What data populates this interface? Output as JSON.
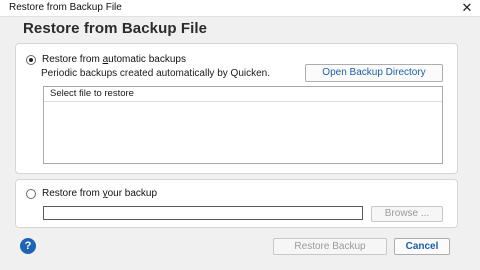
{
  "window": {
    "title": "Restore from Backup File",
    "close_glyph": "✕"
  },
  "heading": "Restore from Backup File",
  "auto_backups": {
    "radio_prefix": "Restore from ",
    "radio_underlined": "a",
    "radio_suffix": "utomatic backups",
    "selected": true,
    "description": "Periodic backups created automatically by Quicken.",
    "open_button": "Open Backup Directory",
    "list_header": "Select file to restore"
  },
  "own_backup": {
    "radio_prefix": "Restore from ",
    "radio_underlined": "y",
    "radio_suffix": "our backup",
    "selected": false,
    "path_value": "",
    "browse_button": "Browse ..."
  },
  "footer": {
    "help_glyph": "?",
    "restore_button": "Restore Backup",
    "cancel_button": "Cancel"
  },
  "colors": {
    "accent": "#1b5fa8",
    "help_icon": "#1f63b5"
  }
}
